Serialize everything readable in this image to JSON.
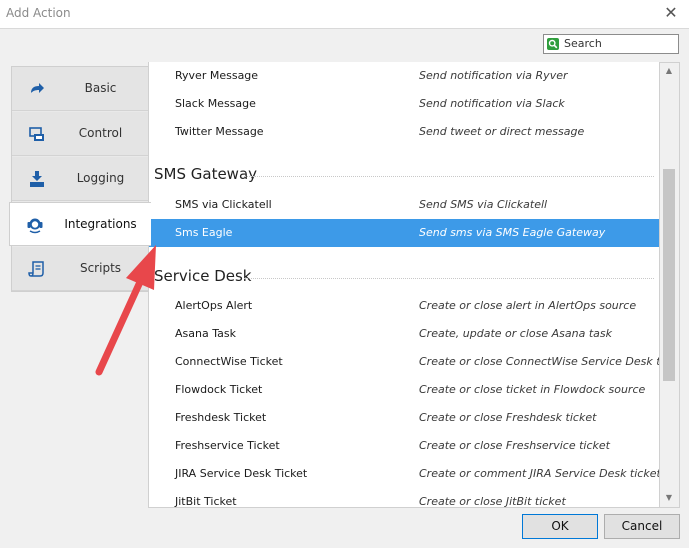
{
  "window": {
    "title": "Add Action",
    "close_glyph": "✕"
  },
  "search": {
    "placeholder": "Search",
    "icon": "search-icon"
  },
  "sidebar": {
    "items": [
      {
        "label": "Basic",
        "icon": "arrow-right-icon",
        "active": false
      },
      {
        "label": "Control",
        "icon": "monitor-icon",
        "active": false
      },
      {
        "label": "Logging",
        "icon": "download-icon",
        "active": false
      },
      {
        "label": "Integrations",
        "icon": "headset-icon",
        "active": true
      },
      {
        "label": "Scripts",
        "icon": "script-icon",
        "active": false
      }
    ]
  },
  "list": {
    "top_rows": [
      {
        "name": "Ryver Message",
        "desc": "Send notification via Ryver"
      },
      {
        "name": "Slack Message",
        "desc": "Send notification via Slack"
      },
      {
        "name": "Twitter Message",
        "desc": "Send tweet or direct message"
      }
    ],
    "groups": [
      {
        "title": "SMS Gateway",
        "rows": [
          {
            "name": "SMS via Clickatell",
            "desc": "Send SMS via Clickatell",
            "selected": false
          },
          {
            "name": "Sms Eagle",
            "desc": "Send sms via SMS Eagle Gateway",
            "selected": true
          }
        ]
      },
      {
        "title": "Service Desk",
        "rows": [
          {
            "name": "AlertOps Alert",
            "desc": "Create or close alert in AlertOps source"
          },
          {
            "name": "Asana Task",
            "desc": "Create, update or close Asana task"
          },
          {
            "name": "ConnectWise Ticket",
            "desc": "Create or close ConnectWise Service Desk ticket"
          },
          {
            "name": "Flowdock Ticket",
            "desc": "Create or close ticket in Flowdock source"
          },
          {
            "name": "Freshdesk Ticket",
            "desc": "Create or close Freshdesk ticket"
          },
          {
            "name": "Freshservice Ticket",
            "desc": "Create or close Freshservice ticket"
          },
          {
            "name": "JIRA Service Desk Ticket",
            "desc": "Create or comment JIRA Service Desk ticket"
          },
          {
            "name": "JitBit Ticket",
            "desc": "Create or close JitBit ticket"
          }
        ]
      }
    ]
  },
  "buttons": {
    "ok": "OK",
    "cancel": "Cancel"
  },
  "colors": {
    "selection": "#3d9ae8",
    "annotation_arrow": "#e8474b",
    "search_icon": "#2e9e3c"
  }
}
